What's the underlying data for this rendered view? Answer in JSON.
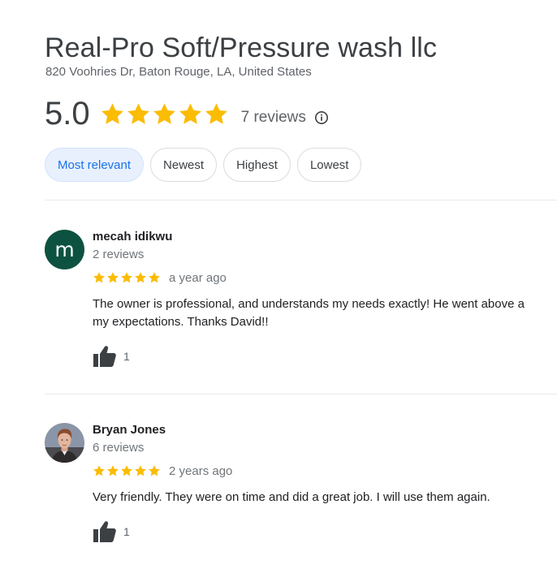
{
  "business": {
    "name": "Real-Pro Soft/Pressure wash llc",
    "address": "820 Voohries Dr, Baton Rouge, LA, United States",
    "rating": "5.0",
    "stars": 5,
    "review_count_label": "7 reviews"
  },
  "filters": [
    "Most relevant",
    "Newest",
    "Highest",
    "Lowest"
  ],
  "active_filter": "Most relevant",
  "colors": {
    "star": "#fbbc04",
    "accent": "#1a73e8",
    "avatar_m": "#0d5240"
  },
  "reviews": [
    {
      "avatar_letter": "m",
      "name": "mecah idikwu",
      "reviewer_reviews": "2 reviews",
      "stars": 5,
      "time": "a year ago",
      "text": "The owner is professional, and understands my needs exactly! He went above a\nmy expectations. Thanks David!!",
      "likes": "1"
    },
    {
      "avatar_letter": "",
      "name": "Bryan Jones",
      "reviewer_reviews": "6 reviews",
      "stars": 5,
      "time": "2 years ago",
      "text": "Very friendly. They were on time and did a great job. I will use them again.",
      "likes": "1"
    }
  ]
}
